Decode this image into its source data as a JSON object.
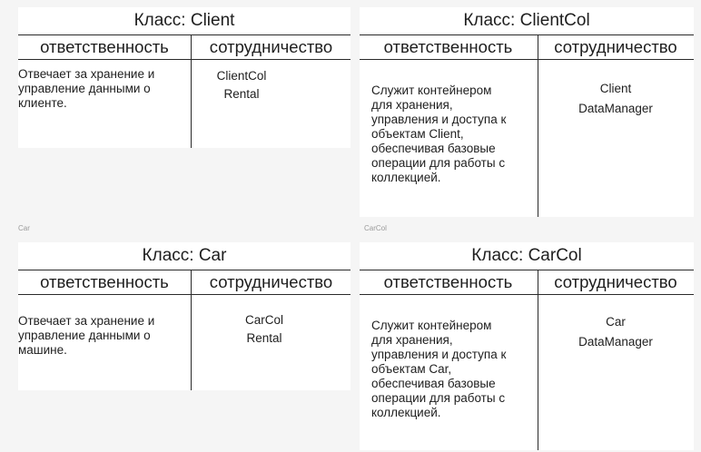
{
  "cards": [
    {
      "title": "Класс: Client",
      "resp_header": "ответственность",
      "collab_header": "сотрудничество",
      "responsibility": "Отвечает за хранение и\nуправление данными о\nклиенте.",
      "collaborators": [
        "ClientCol",
        "Rental"
      ]
    },
    {
      "title": "Класс: ClientCol",
      "resp_header": "ответственность",
      "collab_header": "сотрудничество",
      "responsibility": "Служит контейнером\nдля хранения,\nуправления и доступа к\nобъектам Client,\nобеспечивая базовые\nоперации для работы с\nколлекцией.",
      "collaborators": [
        "Client",
        "DataManager"
      ]
    },
    {
      "title": "Класс: Car",
      "resp_header": "ответственность",
      "collab_header": "сотрудничество",
      "responsibility": "Отвечает за хранение и\nуправление данными о\nмашине.",
      "collaborators": [
        "CarCol",
        "Rental"
      ]
    },
    {
      "title": "Класс: CarCol",
      "resp_header": "ответственность",
      "collab_header": "сотрудничество",
      "responsibility": "Служит контейнером\nдля хранения,\nуправления и доступа к\nобъектам Car,\nобеспечивая базовые\nоперации для работы с\nколлекцией.",
      "collaborators": [
        "Car",
        "DataManager"
      ]
    }
  ],
  "captions": [
    "Car",
    "CarCol"
  ]
}
